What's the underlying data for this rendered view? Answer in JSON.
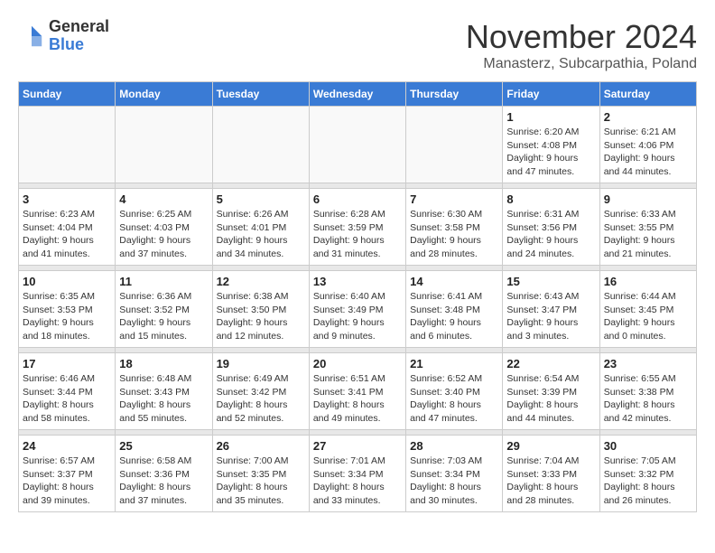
{
  "logo": {
    "general": "General",
    "blue": "Blue"
  },
  "header": {
    "month": "November 2024",
    "location": "Manasterz, Subcarpathia, Poland"
  },
  "weekdays": [
    "Sunday",
    "Monday",
    "Tuesday",
    "Wednesday",
    "Thursday",
    "Friday",
    "Saturday"
  ],
  "weeks": [
    [
      {
        "day": "",
        "info": ""
      },
      {
        "day": "",
        "info": ""
      },
      {
        "day": "",
        "info": ""
      },
      {
        "day": "",
        "info": ""
      },
      {
        "day": "",
        "info": ""
      },
      {
        "day": "1",
        "info": "Sunrise: 6:20 AM\nSunset: 4:08 PM\nDaylight: 9 hours\nand 47 minutes."
      },
      {
        "day": "2",
        "info": "Sunrise: 6:21 AM\nSunset: 4:06 PM\nDaylight: 9 hours\nand 44 minutes."
      }
    ],
    [
      {
        "day": "3",
        "info": "Sunrise: 6:23 AM\nSunset: 4:04 PM\nDaylight: 9 hours\nand 41 minutes."
      },
      {
        "day": "4",
        "info": "Sunrise: 6:25 AM\nSunset: 4:03 PM\nDaylight: 9 hours\nand 37 minutes."
      },
      {
        "day": "5",
        "info": "Sunrise: 6:26 AM\nSunset: 4:01 PM\nDaylight: 9 hours\nand 34 minutes."
      },
      {
        "day": "6",
        "info": "Sunrise: 6:28 AM\nSunset: 3:59 PM\nDaylight: 9 hours\nand 31 minutes."
      },
      {
        "day": "7",
        "info": "Sunrise: 6:30 AM\nSunset: 3:58 PM\nDaylight: 9 hours\nand 28 minutes."
      },
      {
        "day": "8",
        "info": "Sunrise: 6:31 AM\nSunset: 3:56 PM\nDaylight: 9 hours\nand 24 minutes."
      },
      {
        "day": "9",
        "info": "Sunrise: 6:33 AM\nSunset: 3:55 PM\nDaylight: 9 hours\nand 21 minutes."
      }
    ],
    [
      {
        "day": "10",
        "info": "Sunrise: 6:35 AM\nSunset: 3:53 PM\nDaylight: 9 hours\nand 18 minutes."
      },
      {
        "day": "11",
        "info": "Sunrise: 6:36 AM\nSunset: 3:52 PM\nDaylight: 9 hours\nand 15 minutes."
      },
      {
        "day": "12",
        "info": "Sunrise: 6:38 AM\nSunset: 3:50 PM\nDaylight: 9 hours\nand 12 minutes."
      },
      {
        "day": "13",
        "info": "Sunrise: 6:40 AM\nSunset: 3:49 PM\nDaylight: 9 hours\nand 9 minutes."
      },
      {
        "day": "14",
        "info": "Sunrise: 6:41 AM\nSunset: 3:48 PM\nDaylight: 9 hours\nand 6 minutes."
      },
      {
        "day": "15",
        "info": "Sunrise: 6:43 AM\nSunset: 3:47 PM\nDaylight: 9 hours\nand 3 minutes."
      },
      {
        "day": "16",
        "info": "Sunrise: 6:44 AM\nSunset: 3:45 PM\nDaylight: 9 hours\nand 0 minutes."
      }
    ],
    [
      {
        "day": "17",
        "info": "Sunrise: 6:46 AM\nSunset: 3:44 PM\nDaylight: 8 hours\nand 58 minutes."
      },
      {
        "day": "18",
        "info": "Sunrise: 6:48 AM\nSunset: 3:43 PM\nDaylight: 8 hours\nand 55 minutes."
      },
      {
        "day": "19",
        "info": "Sunrise: 6:49 AM\nSunset: 3:42 PM\nDaylight: 8 hours\nand 52 minutes."
      },
      {
        "day": "20",
        "info": "Sunrise: 6:51 AM\nSunset: 3:41 PM\nDaylight: 8 hours\nand 49 minutes."
      },
      {
        "day": "21",
        "info": "Sunrise: 6:52 AM\nSunset: 3:40 PM\nDaylight: 8 hours\nand 47 minutes."
      },
      {
        "day": "22",
        "info": "Sunrise: 6:54 AM\nSunset: 3:39 PM\nDaylight: 8 hours\nand 44 minutes."
      },
      {
        "day": "23",
        "info": "Sunrise: 6:55 AM\nSunset: 3:38 PM\nDaylight: 8 hours\nand 42 minutes."
      }
    ],
    [
      {
        "day": "24",
        "info": "Sunrise: 6:57 AM\nSunset: 3:37 PM\nDaylight: 8 hours\nand 39 minutes."
      },
      {
        "day": "25",
        "info": "Sunrise: 6:58 AM\nSunset: 3:36 PM\nDaylight: 8 hours\nand 37 minutes."
      },
      {
        "day": "26",
        "info": "Sunrise: 7:00 AM\nSunset: 3:35 PM\nDaylight: 8 hours\nand 35 minutes."
      },
      {
        "day": "27",
        "info": "Sunrise: 7:01 AM\nSunset: 3:34 PM\nDaylight: 8 hours\nand 33 minutes."
      },
      {
        "day": "28",
        "info": "Sunrise: 7:03 AM\nSunset: 3:34 PM\nDaylight: 8 hours\nand 30 minutes."
      },
      {
        "day": "29",
        "info": "Sunrise: 7:04 AM\nSunset: 3:33 PM\nDaylight: 8 hours\nand 28 minutes."
      },
      {
        "day": "30",
        "info": "Sunrise: 7:05 AM\nSunset: 3:32 PM\nDaylight: 8 hours\nand 26 minutes."
      }
    ]
  ]
}
